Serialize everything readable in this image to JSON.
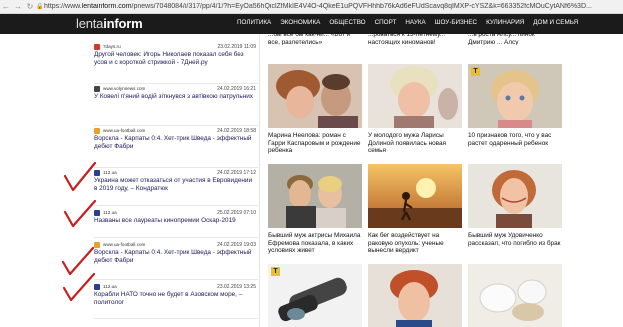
{
  "browser": {
    "url_prefix": "https://www.",
    "url_host": "lentainform.com",
    "url_path": "/pnews/7048084/i/317/pp/4/1/?h=EyOa56hQiclZfMkIE4V4O-4QkeE1uPQVFHhhb76kAd6eFUdScavq8qIMXP-cYSZ&k=663352fcMOuCytANf6%3D..."
  },
  "header": {
    "logo_light": "lenta",
    "logo_bold": "inform",
    "menu": [
      "ПОЛИТИКА",
      "ЭКОНОМИКА",
      "ОБЩЕСТВО",
      "СПОРТ",
      "НАУКА",
      "ШОУ-БИЗНЕС",
      "КУЛИНАРИЯ",
      "ДОМ И СЕМЬЯ"
    ]
  },
  "sidebar": {
    "items": [
      {
        "source": "7days.ru",
        "icon_color": "#d0392b",
        "date": "23.02.2019 11:09",
        "title": "Другой человек: Игорь Николаев показал себя без усов и с короткой стрижкой - 7Дней.ру"
      },
      {
        "source": "www.volynnews.com",
        "icon_color": "#444444",
        "date": "24.02.2019 16:21",
        "title": "У Ковелі п'яний водій зіткнувся з автівкою патрульних"
      },
      {
        "source": "www.ua-football.com",
        "icon_color": "#e8a12a",
        "date": "24.02.2019 18:58",
        "title": "Ворскла - Карпаты 0:4. Хет-трик Шведа - эффектный дебют Фабри"
      },
      {
        "source": "112.ua",
        "icon_color": "#2b3f8c",
        "date": "24.02.2019 17:12",
        "title": "Украина может отказаться от участия в Евровидении в 2019 году, – Кондратюк"
      },
      {
        "source": "112.ua",
        "icon_color": "#2b3f8c",
        "date": "25.02.2019 07:10",
        "title": "Названы все лауреаты кинопремии Оскар-2019"
      },
      {
        "source": "www.ua-football.com",
        "icon_color": "#e8a12a",
        "date": "24.02.2019 19:03",
        "title": "Ворскла - Карпаты 0:4. Хет-трик Шведа - эффектный дебют Фабри"
      },
      {
        "source": "112.ua",
        "icon_color": "#2b3f8c",
        "date": "23.02.2019 13:25",
        "title": "Корабли НАТО точно не будет в Азовском море, – политолог"
      }
    ]
  },
  "grid": {
    "top_captions": [
      "...бы все бы как-ни... «Вот и все, разлетелись»",
      "...роваться к 13-летнему... настоящих киноманов!",
      "...ь роста Алсу... пинок Дмитрию ... Алсу"
    ],
    "row1": [
      {
        "caption": "Марина Неелова: роман с Гарри Каспаровым и рождение ребенка",
        "badge": ""
      },
      {
        "caption": "У молодого мужа Ларисы Долиной появилась новая семья",
        "badge": ""
      },
      {
        "caption": "10 признаков того, что у вас растет одаренный ребенок",
        "badge": "T"
      }
    ],
    "row2": [
      {
        "caption": "Бывший муж актрисы Михаила Ефремова показала, в каких условиях живет",
        "badge": ""
      },
      {
        "caption": "Как бег воздействует на раковую опухоль: ученые вынесли вердикт",
        "badge": ""
      },
      {
        "caption": "Бывший муж Удовиченко рассказал, что погибло из брак",
        "badge": ""
      }
    ],
    "row3": [
      {
        "caption": "",
        "badge": "T"
      },
      {
        "caption": "",
        "badge": ""
      },
      {
        "caption": "",
        "badge": ""
      }
    ]
  },
  "annotations": {
    "check_color": "#c81e1e",
    "check_count": 4
  }
}
